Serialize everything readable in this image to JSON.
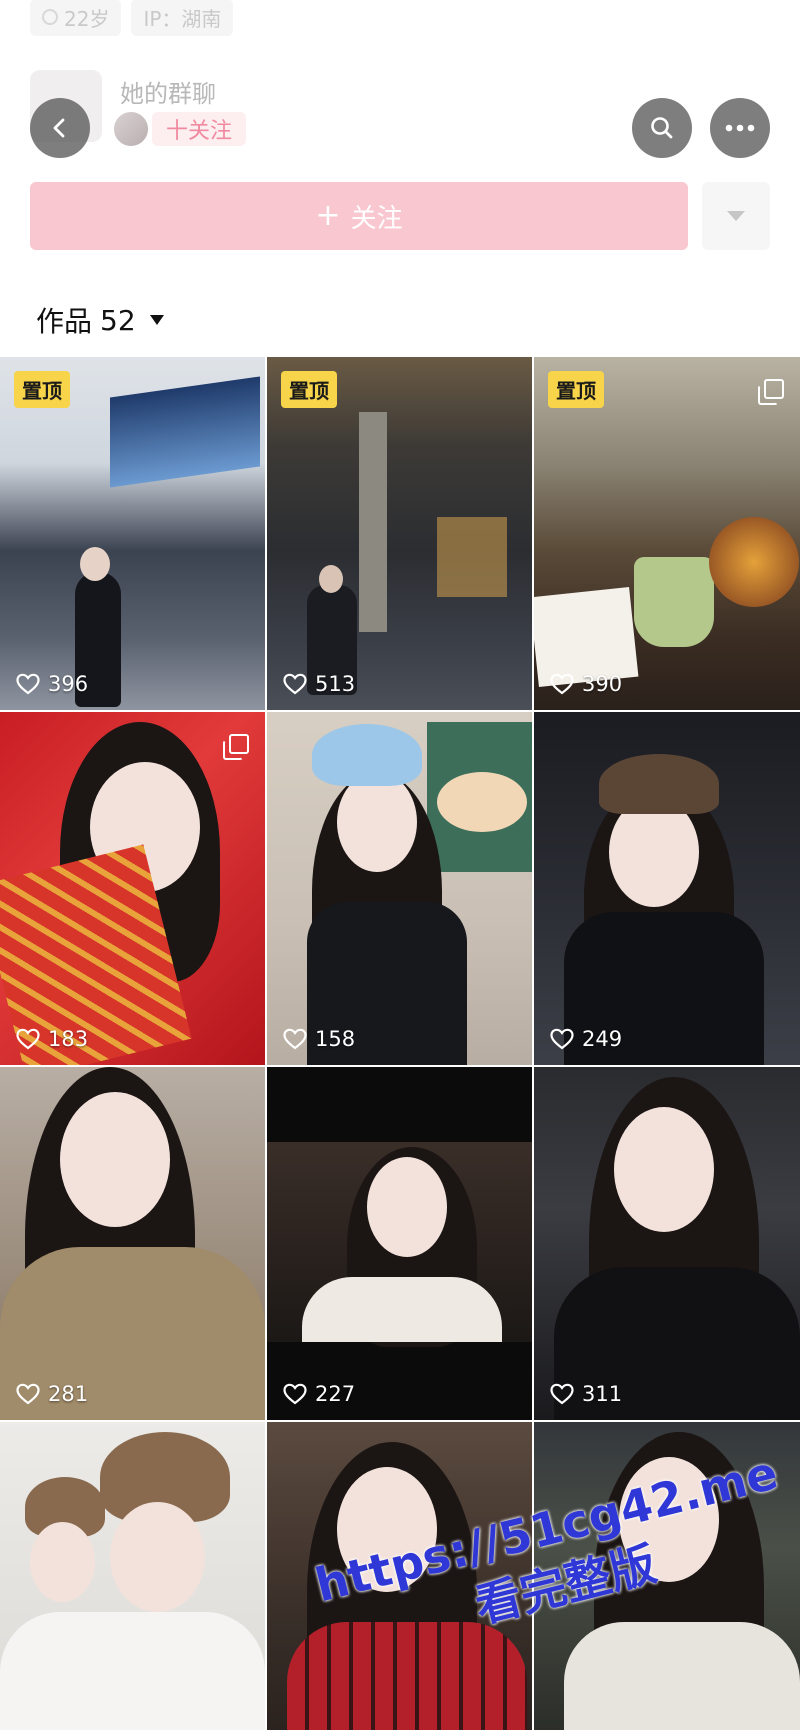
{
  "profile_meta": {
    "age": "22岁",
    "ip": "IP：湖南"
  },
  "group_chat": {
    "title": "她的群聊",
    "follow_chip": "十关注"
  },
  "follow_button": {
    "plus": "+",
    "label": "关注"
  },
  "works": {
    "label": "作品",
    "count": "52"
  },
  "pin_label": "置顶",
  "posts": [
    {
      "likes": "396",
      "pinned": true,
      "multi": false
    },
    {
      "likes": "513",
      "pinned": true,
      "multi": false
    },
    {
      "likes": "390",
      "pinned": true,
      "multi": true
    },
    {
      "likes": "183",
      "pinned": false,
      "multi": true
    },
    {
      "likes": "158",
      "pinned": false,
      "multi": false
    },
    {
      "likes": "249",
      "pinned": false,
      "multi": false
    },
    {
      "likes": "281",
      "pinned": false,
      "multi": false
    },
    {
      "likes": "227",
      "pinned": false,
      "multi": false
    },
    {
      "likes": "311",
      "pinned": false,
      "multi": false
    },
    {
      "likes": "",
      "pinned": false,
      "multi": false
    },
    {
      "likes": "",
      "pinned": false,
      "multi": false
    },
    {
      "likes": "",
      "pinned": false,
      "multi": false
    }
  ],
  "watermark": {
    "url": "https://51cg42.me",
    "text": "看完整版"
  },
  "icons": {
    "back": "chevron-left-icon",
    "search": "search-icon",
    "more": "more-dots-icon",
    "heart": "heart-icon",
    "dropdown": "triangle-down-icon"
  },
  "colors": {
    "follow_bg": "#f9c7cf",
    "pin_badge": "#f7d44a",
    "watermark": "#2f37d6"
  }
}
